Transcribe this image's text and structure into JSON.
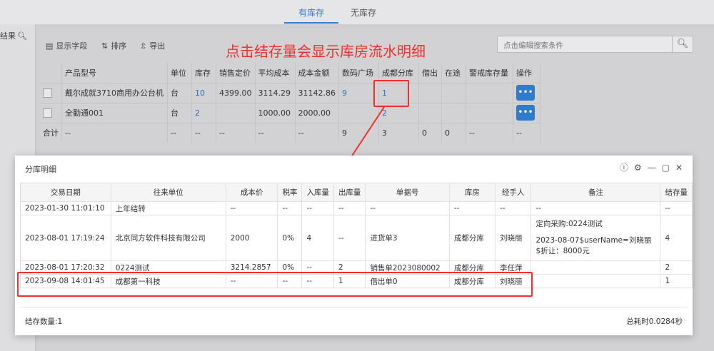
{
  "tabs": [
    "有库存",
    "无库存"
  ],
  "left": {
    "filter_label": "结果"
  },
  "toolbar": {
    "show_fields": "显示字段",
    "sort": "排序",
    "export": "导出"
  },
  "annotation": "点击结存量会显示库房流水明细",
  "search": {
    "placeholder": "点击编辑搜索条件"
  },
  "grid": {
    "columns": [
      "产品型号",
      "单位",
      "库存",
      "销售定价",
      "平均成本",
      "成本金额",
      "数码广场",
      "成都分库",
      "借出",
      "在途",
      "警戒库存量",
      "操作"
    ],
    "rows": [
      {
        "model": "戴尔成就3710商用办公台机",
        "unit": "台",
        "stock": "10",
        "price": "4399.00",
        "avg_cost": "3114.29",
        "cost_amount": "31142.86",
        "digital_plaza": "9",
        "chengdu": "1",
        "lent": "",
        "transit": "",
        "alert": "",
        "op": "•••"
      },
      {
        "model": "全勤通001",
        "unit": "台",
        "stock": "2",
        "price": "",
        "avg_cost": "1000.00",
        "cost_amount": "2000.00",
        "digital_plaza": "",
        "chengdu": "2",
        "lent": "",
        "transit": "",
        "alert": "",
        "op": "•••"
      }
    ],
    "total": {
      "label": "合计",
      "model": "--",
      "unit": "--",
      "stock": "--",
      "price": "--",
      "avg_cost": "--",
      "cost_amount": "--",
      "digital_plaza": "9",
      "chengdu": "3",
      "lent": "0",
      "transit": "0",
      "alert": "--",
      "op": "--"
    }
  },
  "modal": {
    "title": "分库明细",
    "columns": [
      "交易日期",
      "往来单位",
      "成本价",
      "税率",
      "入库量",
      "出库量",
      "单据号",
      "库房",
      "经手人",
      "备注",
      "结存量"
    ],
    "rows": [
      {
        "date": "2023-01-30 11:01:10",
        "partner": "上年结转",
        "cost": "--",
        "tax": "--",
        "in": "--",
        "out": "--",
        "doc": "--",
        "warehouse": "--",
        "handler": "--",
        "remark": "--",
        "balance": "--"
      },
      {
        "date": "2023-08-01 17:19:24",
        "partner": "北京同方软件科技有限公司",
        "cost": "2000",
        "tax": "0%",
        "in": "4",
        "out": "--",
        "doc": "进货单3",
        "warehouse": "成都分库",
        "handler": "刘晓丽",
        "remark_line1": "定向采购:0224测试",
        "remark_line2": "2023-08-07$userName=刘晓丽$折让：8000元",
        "balance": "4"
      },
      {
        "date": "2023-08-01 17:20:32",
        "partner": "0224测试",
        "cost": "3214.2857",
        "tax": "0%",
        "in": "--",
        "out": "2",
        "doc": "销售单2023080002",
        "warehouse": "成都分库",
        "handler": "李任萍",
        "remark": "",
        "balance": "2"
      },
      {
        "date": "2023-09-08 14:01:45",
        "partner": "成都第一科技",
        "cost": "--",
        "tax": "--",
        "in": "--",
        "out": "1",
        "doc": "借出单0",
        "warehouse": "成都分库",
        "handler": "刘晓丽",
        "remark": "",
        "balance": "1"
      }
    ],
    "footer_left": "结存数量:1",
    "footer_right": "总耗时0.0284秒"
  },
  "colors": {
    "accent": "#2f7ccf",
    "highlight": "#f0302c"
  }
}
